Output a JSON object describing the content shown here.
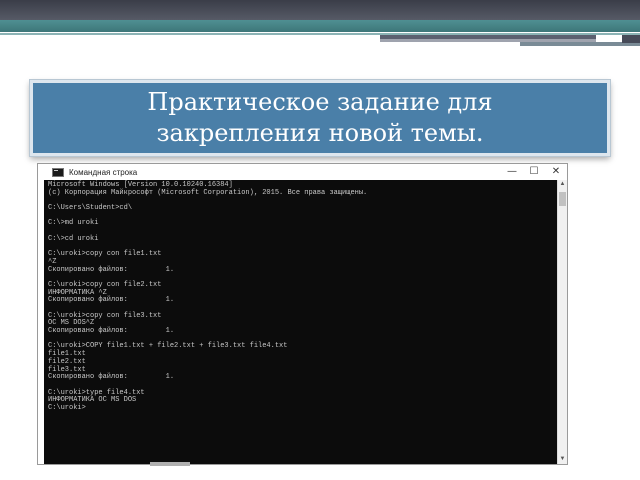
{
  "slide": {
    "title": "Практическое задание для закрепления новой темы."
  },
  "window": {
    "title": "Командная строка",
    "controls": {
      "minimize": "—",
      "maximize": "☐",
      "close": "✕"
    }
  },
  "scrollbar": {
    "up": "▲",
    "down": "▼"
  },
  "console": {
    "lines": [
      "Microsoft Windows [Version 10.0.10240.16384]",
      "(c) Корпорация Майкрософт (Microsoft Corporation), 2015. Все права защищены.",
      "",
      "C:\\Users\\Student>cd\\",
      "",
      "C:\\>md uroki",
      "",
      "C:\\>cd uroki",
      "",
      "C:\\uroki>copy con file1.txt",
      "^Z",
      "Скопировано файлов:         1.",
      "",
      "C:\\uroki>copy con file2.txt",
      "ИНФОРМАТИКА ^Z",
      "Скопировано файлов:         1.",
      "",
      "C:\\uroki>copy con file3.txt",
      "ОС MS DOS^Z",
      "Скопировано файлов:         1.",
      "",
      "C:\\uroki>COPY file1.txt + file2.txt + file3.txt file4.txt",
      "file1.txt",
      "file2.txt",
      "file3.txt",
      "Скопировано файлов:         1.",
      "",
      "C:\\uroki>type file4.txt",
      "ИНФОРМАТИКА ОС MS DOS",
      "C:\\uroki>"
    ]
  }
}
